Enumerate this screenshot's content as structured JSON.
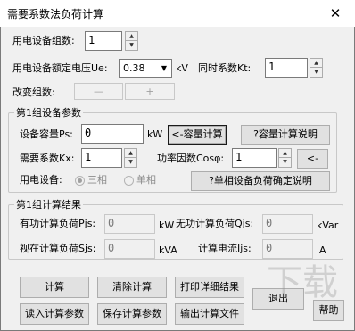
{
  "window": {
    "title": "需要系数法负荷计算",
    "close_glyph": "✕"
  },
  "top": {
    "device_groups_label": "用电设备组数:",
    "device_groups_value": "1",
    "rated_voltage_label": "用电设备额定电压Ue:",
    "rated_voltage_value": "0.38",
    "rated_voltage_unit": "kV",
    "simultaneity_label": "同时系数Kt:",
    "simultaneity_value": "1",
    "change_group_label": "改变组数:",
    "minus_label": "—",
    "plus_label": "+"
  },
  "group_params": {
    "title": "第1组设备参数",
    "capacity_label": "设备容量Ps:",
    "capacity_value": "0",
    "capacity_unit": "kW",
    "capacity_calc_button": "<-容量计算",
    "capacity_help_button": "?容量计算说明",
    "demand_label": "需要系数Kx:",
    "demand_value": "1",
    "power_factor_label": "功率因数Cosφ:",
    "power_factor_value": "1",
    "arrow_button": "<-",
    "device_label": "用电设备:",
    "three_phase_label": "三相",
    "single_phase_label": "单相",
    "single_phase_help_button": "?单相设备负荷确定说明"
  },
  "group_results": {
    "title": "第1组计算结果",
    "active_label": "有功计算负荷Pjs:",
    "active_value": "0",
    "active_unit": "kW",
    "reactive_label": "无功计算负荷Qjs:",
    "reactive_value": "0",
    "reactive_unit": "kVar",
    "apparent_label": "视在计算负荷Sjs:",
    "apparent_value": "0",
    "apparent_unit": "kVA",
    "current_label": "计算电流Ijs:",
    "current_value": "0",
    "current_unit": "A"
  },
  "buttons": {
    "calculate": "计算",
    "clear": "清除计算",
    "print": "打印详细结果",
    "exit": "退出",
    "load_params": "读入计算参数",
    "save_params": "保存计算参数",
    "export_file": "输出计算文件",
    "help": "帮助"
  },
  "watermark": "下载"
}
